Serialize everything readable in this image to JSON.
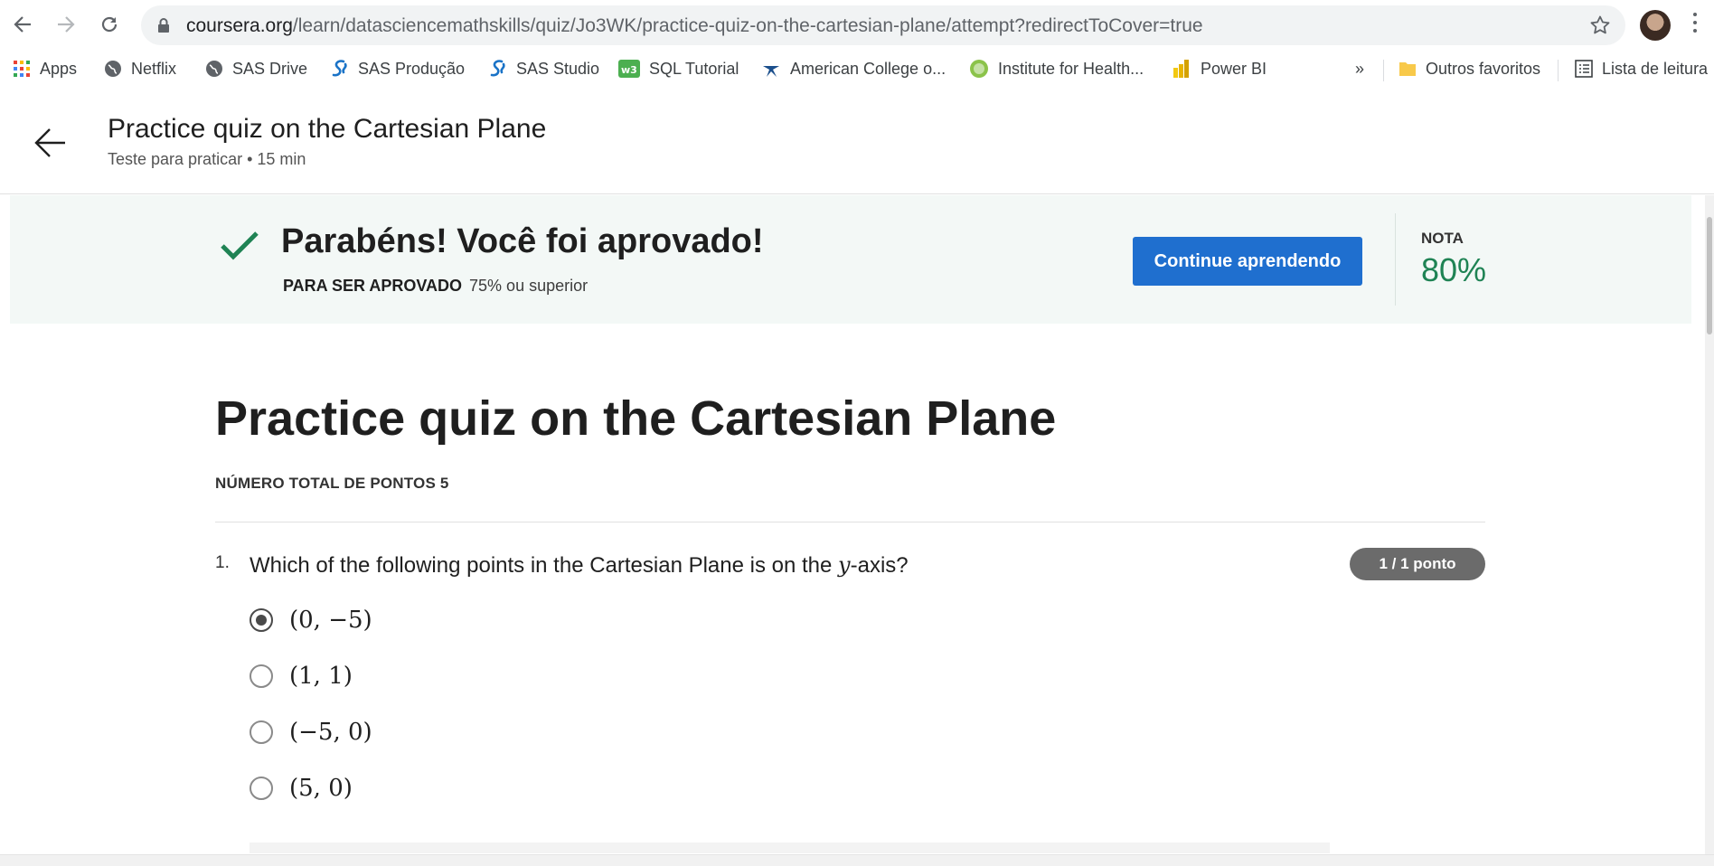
{
  "browser": {
    "url_host": "coursera.org",
    "url_path": "/learn/datasciencemathskills/quiz/Jo3WK/practice-quiz-on-the-cartesian-plane/attempt?redirectToCover=true",
    "bookmarks": [
      {
        "label": "Apps",
        "icon": "apps-grid-icon"
      },
      {
        "label": "Netflix",
        "icon": "globe-icon"
      },
      {
        "label": "SAS Drive",
        "icon": "globe-icon"
      },
      {
        "label": "SAS Produção",
        "icon": "sas-icon"
      },
      {
        "label": "SAS Studio",
        "icon": "sas-icon"
      },
      {
        "label": "SQL Tutorial",
        "icon": "w3schools-icon"
      },
      {
        "label": "American College o...",
        "icon": "acr-icon"
      },
      {
        "label": "Institute for Health...",
        "icon": "ihme-icon"
      },
      {
        "label": "Power BI",
        "icon": "powerbi-icon"
      }
    ],
    "overflow": "»",
    "other_bookmarks": "Outros favoritos",
    "reading_list": "Lista de leitura"
  },
  "header": {
    "title": "Practice quiz on the Cartesian Plane",
    "subtitle": "Teste para praticar • 15 min"
  },
  "banner": {
    "message": "Parabéns! Você foi aprovado!",
    "requirement_label": "PARA SER APROVADO",
    "requirement_value": "75% ou superior",
    "continue_label": "Continue aprendendo",
    "grade_label": "NOTA",
    "grade_value": "80%",
    "colors": {
      "background": "#f3f8f6",
      "button": "#1f6fcf",
      "grade": "#1f8354"
    }
  },
  "quiz": {
    "title": "Practice quiz on the Cartesian Plane",
    "total_points": "NÚMERO TOTAL DE PONTOS 5",
    "questions": [
      {
        "number": "1.",
        "text_before": "Which of the following points in the Cartesian Plane is on the ",
        "text_math": "y",
        "text_after": "-axis?",
        "score": "1 / 1 ponto",
        "options": [
          "(0, −5)",
          "(1, 1)",
          "(−5, 0)",
          "(5, 0)"
        ],
        "selected_index": 0
      }
    ]
  }
}
